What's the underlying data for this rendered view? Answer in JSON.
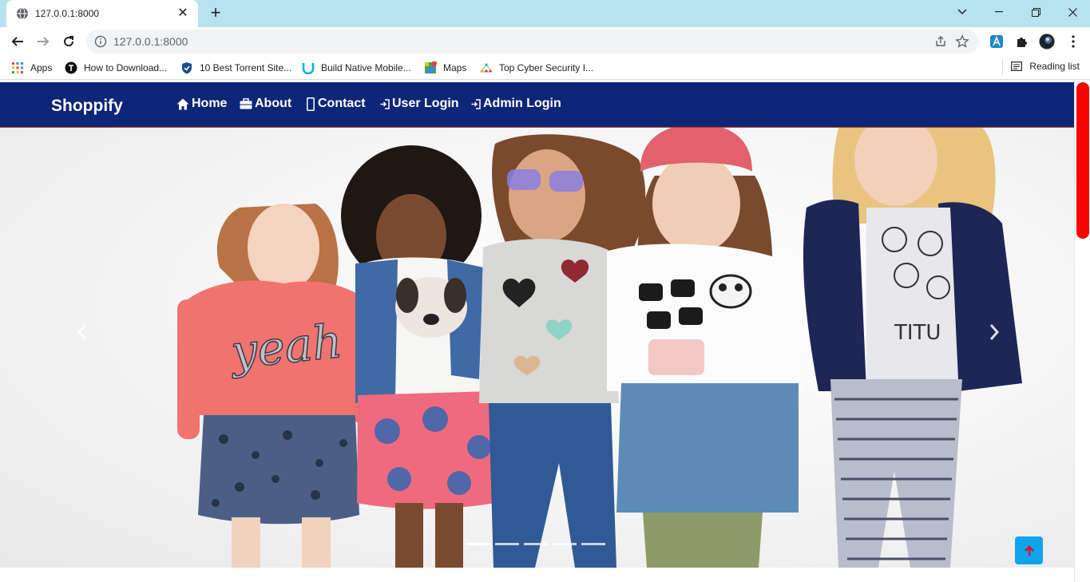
{
  "browser": {
    "tab": {
      "title": "127.0.0.1:8000",
      "favicon": "globe-icon",
      "close": "✕"
    },
    "new_tab": "+",
    "window_controls": [
      "chevron-down-icon",
      "minimize-icon",
      "restore-icon",
      "close-icon"
    ],
    "address": {
      "url": "127.0.0.1:8000"
    },
    "bookmarks": [
      {
        "label": "Apps",
        "icon": "apps-grid-icon"
      },
      {
        "label": "How to Download...",
        "icon": "black-circle-icon"
      },
      {
        "label": "10 Best Torrent Site...",
        "icon": "shield-icon"
      },
      {
        "label": "Build Native Mobile...",
        "icon": "u-logo-icon"
      },
      {
        "label": "Maps",
        "icon": "maps-icon"
      },
      {
        "label": "Top Cyber Security I...",
        "icon": "network-icon"
      }
    ],
    "reading_list": "Reading list"
  },
  "site": {
    "brand": "Shoppify",
    "nav": [
      {
        "label": "Home",
        "icon": "home-icon"
      },
      {
        "label": "About",
        "icon": "briefcase-icon"
      },
      {
        "label": "Contact",
        "icon": "phone-icon"
      },
      {
        "label": "User Login",
        "icon": "login-icon"
      },
      {
        "label": "Admin Login",
        "icon": "login-icon"
      }
    ]
  },
  "carousel": {
    "image": "kids-fashion-banner",
    "slide_count": 5,
    "active_index": 0
  },
  "colors": {
    "navbar": "#0e2677",
    "accent_red": "#ff0000",
    "scroll_button": "#0fa5ec"
  }
}
